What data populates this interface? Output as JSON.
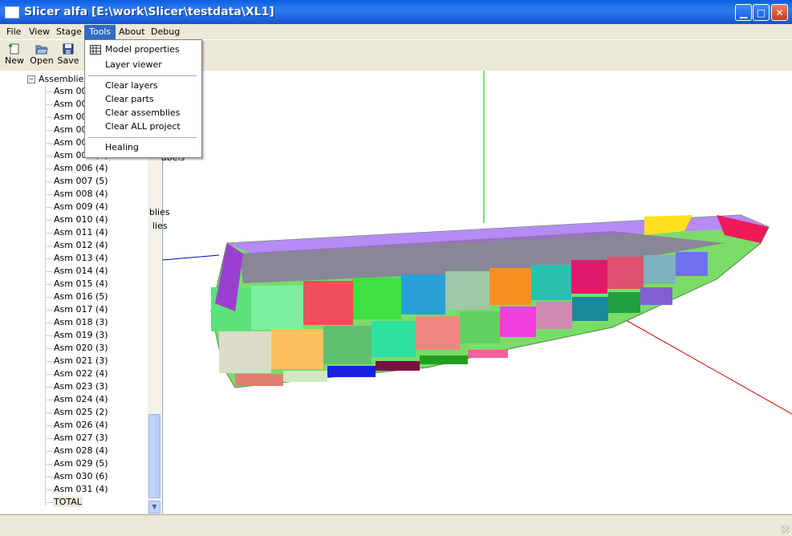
{
  "window": {
    "title": "Slicer alfa [E:\\work\\Slicer\\testdata\\XL1]",
    "controls": [
      "minimize-icon",
      "maximize-icon",
      "close-icon"
    ]
  },
  "menubar": {
    "items": [
      {
        "label": "File"
      },
      {
        "label": "View"
      },
      {
        "label": "Stage"
      },
      {
        "label": "Tools",
        "active": true
      },
      {
        "label": "About"
      },
      {
        "label": "Debug"
      }
    ]
  },
  "toolbar": {
    "new_label": "New",
    "open_label": "Open",
    "save_label": "Save"
  },
  "tools_menu": {
    "items": [
      {
        "label": "Model properties",
        "icon": "grid-icon"
      },
      {
        "label": "Layer viewer"
      },
      {
        "label": "Clear layers"
      },
      {
        "label": "Clear parts"
      },
      {
        "label": "Clear assemblies"
      },
      {
        "label": "Clear ALL project"
      },
      {
        "label": "Healing"
      }
    ]
  },
  "behind_menu_fragments": [
    "abels",
    "blies",
    "lies"
  ],
  "tree": {
    "root": "Assemblies",
    "items": [
      "Asm 000",
      "Asm 001",
      "Asm 002",
      "Asm 003",
      "Asm 004",
      "Asm 005 (5)",
      "Asm 006 (4)",
      "Asm 007 (5)",
      "Asm 008 (4)",
      "Asm 009 (4)",
      "Asm 010 (4)",
      "Asm 011 (4)",
      "Asm 012 (4)",
      "Asm 013 (4)",
      "Asm 014 (4)",
      "Asm 015 (4)",
      "Asm 016 (5)",
      "Asm 017 (4)",
      "Asm 018 (3)",
      "Asm 019 (3)",
      "Asm 020 (3)",
      "Asm 021 (3)",
      "Asm 022 (4)",
      "Asm 023 (3)",
      "Asm 024 (4)",
      "Asm 025 (2)",
      "Asm 026 (4)",
      "Asm 027 (3)",
      "Asm 028 (4)",
      "Asm 029 (5)",
      "Asm 030 (6)",
      "Asm 031 (4)",
      "TOTAL"
    ],
    "selected": "TOTAL"
  },
  "colors": {
    "titlebar": "#0a5fe0",
    "menu_highlight": "#316ac5",
    "axis_x": "#d00000",
    "axis_y": "#00c000",
    "axis_z": "#0000d0"
  }
}
